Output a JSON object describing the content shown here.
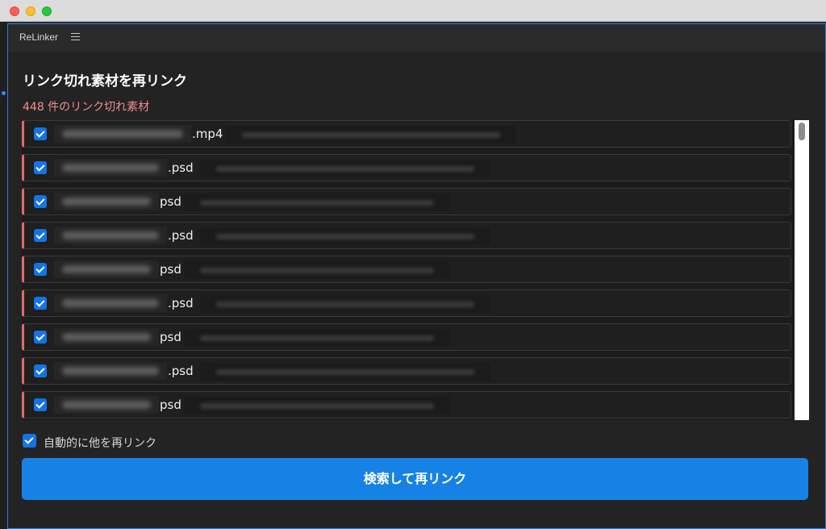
{
  "app": {
    "name": "ReLinker",
    "menu_icon": "hamburger-menu-icon"
  },
  "page": {
    "title": "リンク切れ素材を再リンク",
    "count_text": "448 件のリンク切れ素材"
  },
  "files": [
    {
      "ext": ".mp4",
      "checked": true
    },
    {
      "ext": ".psd",
      "checked": true
    },
    {
      "ext": "psd",
      "checked": true
    },
    {
      "ext": ".psd",
      "checked": true
    },
    {
      "ext": "psd",
      "checked": true
    },
    {
      "ext": ".psd",
      "checked": true
    },
    {
      "ext": "psd",
      "checked": true
    },
    {
      "ext": ".psd",
      "checked": true
    },
    {
      "ext": "psd",
      "checked": true
    }
  ],
  "options": {
    "auto_relink_label": "自動的に他を再リンク",
    "auto_relink_checked": true
  },
  "actions": {
    "search_relink_label": "検索して再リンク"
  },
  "colors": {
    "accent_blue": "#1782e6",
    "error_red": "#e06b6b"
  }
}
